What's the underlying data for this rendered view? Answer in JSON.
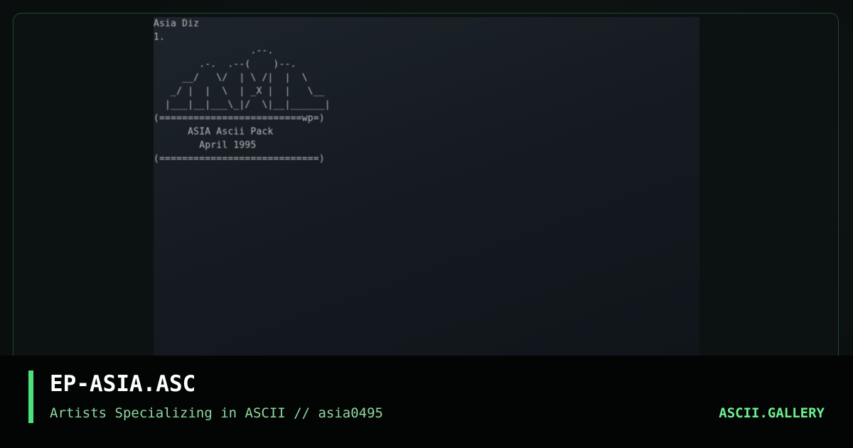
{
  "artwork": {
    "ascii_text": "Asia Diz\n1.\n                 .--.\n        .-.  .--(    )--.\n     __/   \\/  | \\ /|  |  \\\n   _/ |  |  \\  | _X |  |   \\__\n  |___|__|___\\_|/  \\|__|______|\n(=========================wp=)\n      ASIA Ascii Pack\n        April 1995\n(============================)"
  },
  "footer": {
    "title": "EP-ASIA.ASC",
    "subtitle": "Artists Specializing in ASCII // asia0495",
    "brand": "ASCII.GALLERY"
  },
  "colors": {
    "accent": "#4ee07a",
    "brand": "#6ef08f",
    "subtitle": "#8fd7a0",
    "frame_border": "#1f4a2a"
  }
}
